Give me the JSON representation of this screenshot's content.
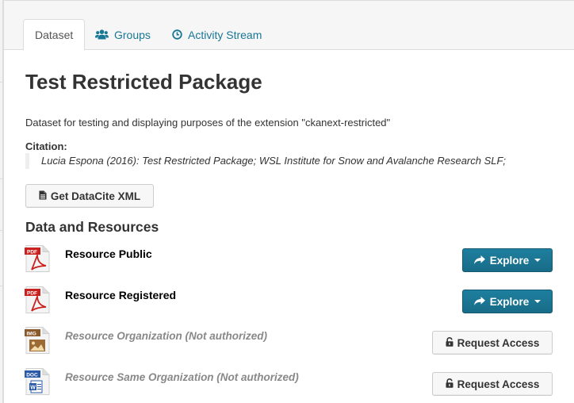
{
  "tabs": [
    {
      "label": "Dataset",
      "icon": "none",
      "active": true
    },
    {
      "label": "Groups",
      "icon": "users-icon",
      "active": false
    },
    {
      "label": "Activity Stream",
      "icon": "clock-icon",
      "active": false
    }
  ],
  "dataset": {
    "title": "Test Restricted Package",
    "description": "Dataset for testing and displaying purposes of the extension \"ckanext-restricted\"",
    "citation_label": "Citation:",
    "citation_text": "Lucia Espona (2016): Test Restricted Package; WSL Institute for Snow and Avalanche Research SLF;",
    "datacite_button": "Get DataCite XML"
  },
  "resources_section": {
    "title": "Data and Resources",
    "items": [
      {
        "name": "Resource Public",
        "format": "PDF",
        "authorized": true,
        "action": "Explore"
      },
      {
        "name": "Resource Registered",
        "format": "PDF",
        "authorized": true,
        "action": "Explore"
      },
      {
        "name": "Resource Organization (Not authorized)",
        "format": "IMG",
        "authorized": false,
        "action": "Request Access"
      },
      {
        "name": "Resource Same Organization (Not authorized)",
        "format": "DOC",
        "authorized": false,
        "action": "Request Access"
      }
    ]
  },
  "colors": {
    "link": "#187794",
    "primary_button": "#1e7f9e",
    "pdf_red": "#c9211e",
    "img_brown": "#8b5a2b",
    "doc_blue": "#2a5aa8",
    "muted_text": "#888888"
  }
}
